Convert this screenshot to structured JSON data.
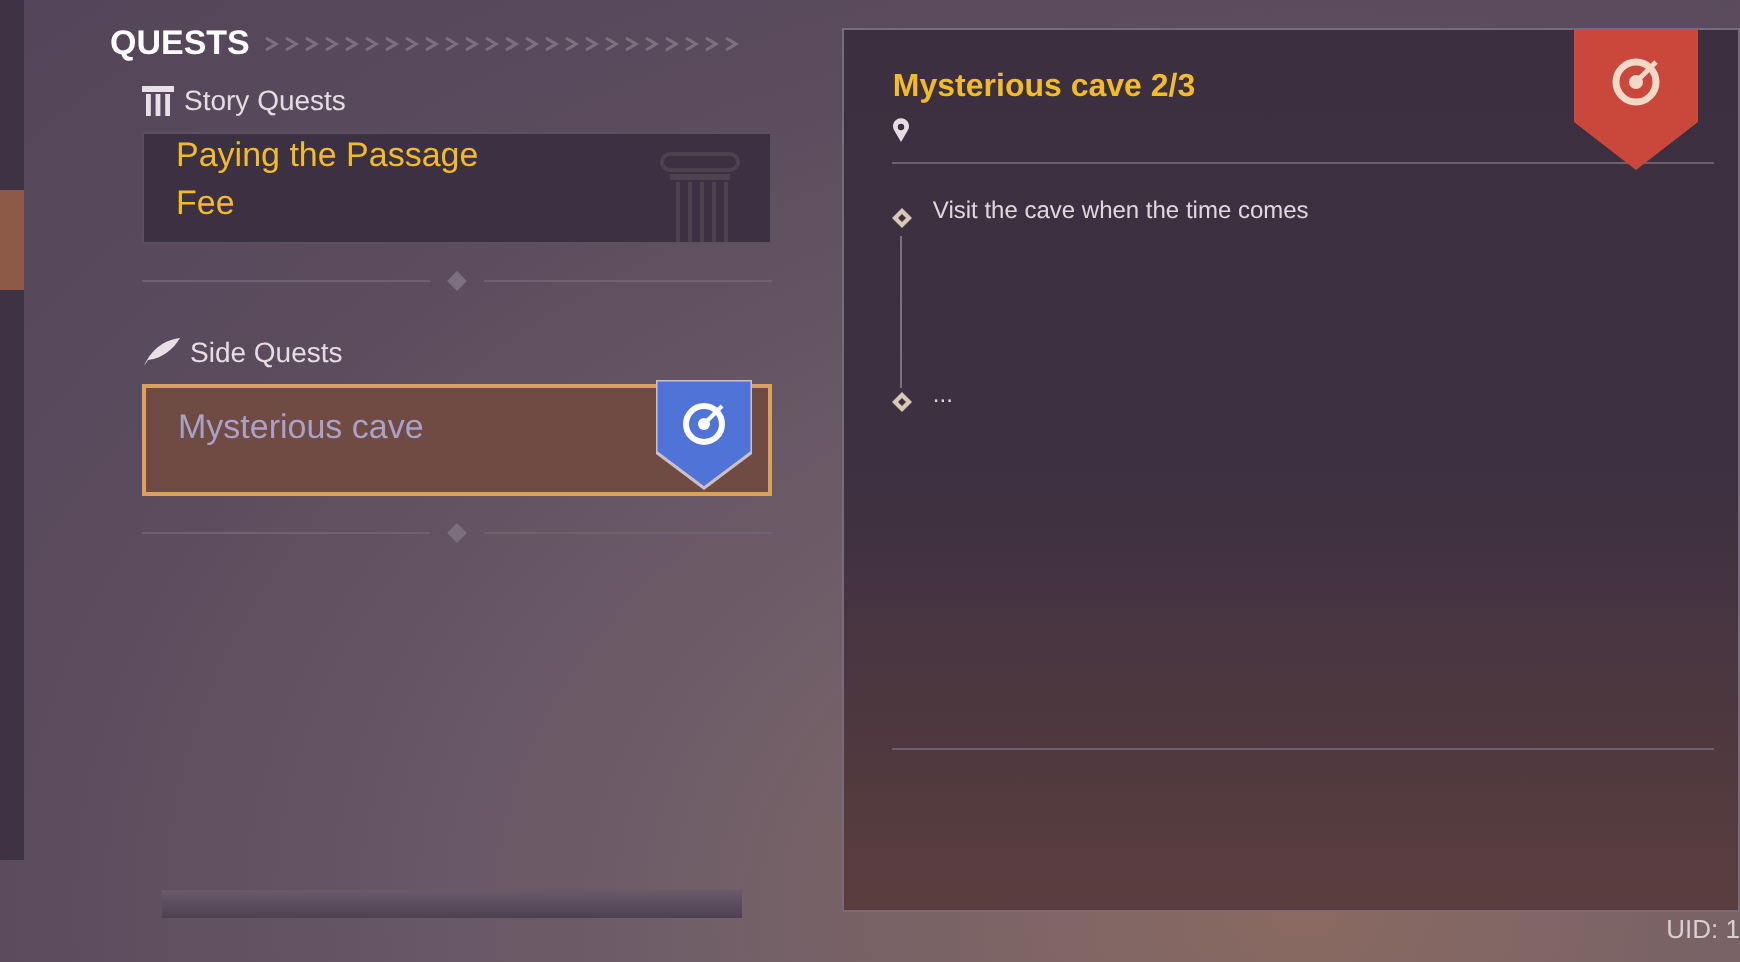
{
  "header": {
    "title": "QUESTS"
  },
  "sections": [
    {
      "kind": "story",
      "title": "Story Quests",
      "quests": [
        {
          "name": "Paying the Passage Fee",
          "selected": false,
          "tracked": false
        }
      ]
    },
    {
      "kind": "side",
      "title": "Side Quests",
      "quests": [
        {
          "name": "Mysterious cave",
          "selected": true,
          "tracked": true
        }
      ]
    }
  ],
  "detail": {
    "title": "Mysterious cave 2/3",
    "tracked": true,
    "steps": [
      {
        "text": "Visit the cave when the time comes"
      },
      {
        "text": "..."
      }
    ]
  },
  "uid": "UID: 1"
}
